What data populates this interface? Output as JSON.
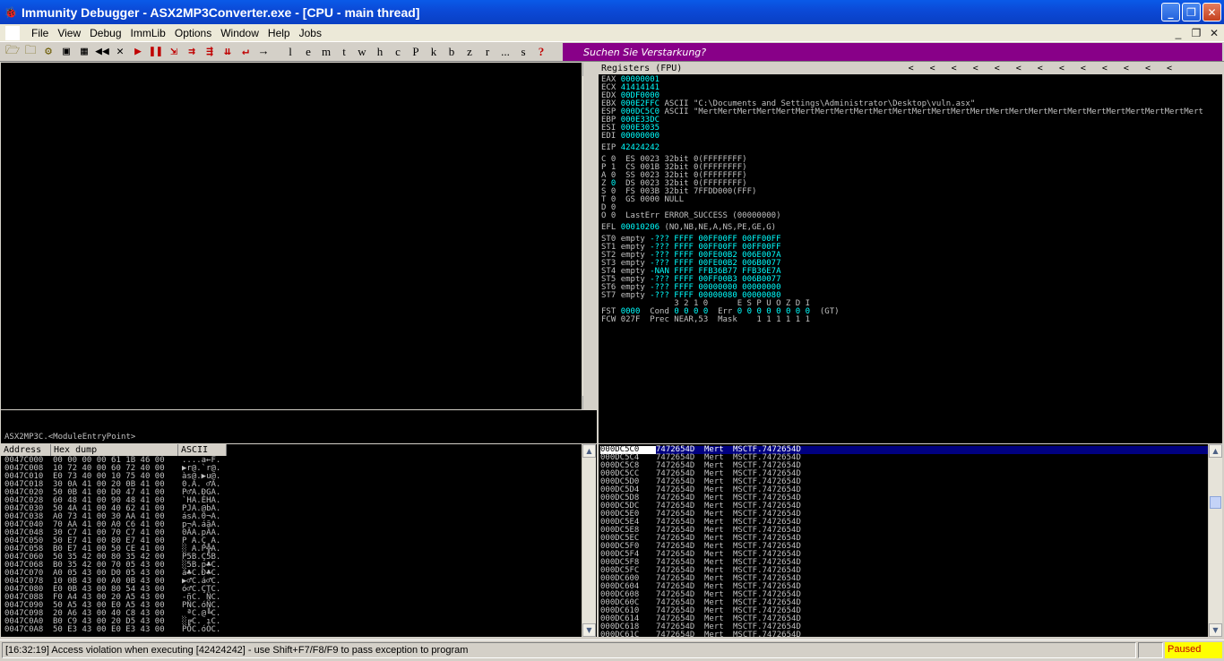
{
  "window": {
    "title": "Immunity Debugger - ASX2MP3Converter.exe - [CPU - main thread]",
    "minimize": "_",
    "restore": "❐",
    "close": "✕"
  },
  "menu": [
    "File",
    "View",
    "Debug",
    "ImmLib",
    "Options",
    "Window",
    "Help",
    "Jobs"
  ],
  "mdi": {
    "min": "_",
    "restore": "❐",
    "close": "✕"
  },
  "toolbar": {
    "icons": [
      {
        "name": "open-icon",
        "glyph": "🗁",
        "cls": "ico"
      },
      {
        "name": "reopen-icon",
        "glyph": "🗀",
        "cls": "ico"
      },
      {
        "name": "attach-icon",
        "glyph": "⚙",
        "cls": "ico"
      },
      {
        "name": "window-icon",
        "glyph": "▣",
        "cls": "blk"
      },
      {
        "name": "cpu-icon",
        "glyph": "▦",
        "cls": "blk"
      },
      {
        "name": "rewind-icon",
        "glyph": "◀◀",
        "cls": "blk"
      },
      {
        "name": "close-program-icon",
        "glyph": "✕",
        "cls": "blk"
      },
      {
        "name": "run-icon",
        "glyph": "▶",
        "cls": "red"
      },
      {
        "name": "pause-icon",
        "glyph": "❚❚",
        "cls": "red"
      },
      {
        "name": "step-into-icon",
        "glyph": "⇲",
        "cls": "red"
      },
      {
        "name": "step-over-icon",
        "glyph": "⇉",
        "cls": "red"
      },
      {
        "name": "trace-into-icon",
        "glyph": "⇶",
        "cls": "red"
      },
      {
        "name": "trace-over-icon",
        "glyph": "⇊",
        "cls": "red"
      },
      {
        "name": "execute-till-return-icon",
        "glyph": "↵",
        "cls": "red"
      },
      {
        "name": "go-to-icon",
        "glyph": "→",
        "cls": "blk"
      }
    ],
    "letters": [
      "l",
      "e",
      "m",
      "t",
      "w",
      "h",
      "c",
      "P",
      "k",
      "b",
      "z",
      "r",
      "...",
      "s",
      "?"
    ],
    "banner": "Suchen Sie Verstarkung?"
  },
  "registers": {
    "header": "Registers (FPU)",
    "arrows": [
      "<",
      "<",
      "<",
      "<",
      "<",
      "<",
      "<",
      "<",
      "<",
      "<",
      "<",
      "<",
      "<"
    ],
    "gp": [
      {
        "name": "EAX",
        "val": "00000001",
        "rest": ""
      },
      {
        "name": "ECX",
        "val": "41414141",
        "rest": ""
      },
      {
        "name": "EDX",
        "val": "00DF0000",
        "rest": ""
      },
      {
        "name": "EBX",
        "val": "000E2FFC",
        "rest": " ASCII \"C:\\Documents and Settings\\Administrator\\Desktop\\vuln.asx\""
      },
      {
        "name": "ESP",
        "val": "000DC5C0",
        "rest": " ASCII \"MertMertMertMertMertMertMertMertMertMertMertMertMertMertMertMertMertMertMertMertMertMertMertMertMertMert"
      },
      {
        "name": "EBP",
        "val": "000E33DC",
        "rest": ""
      },
      {
        "name": "ESI",
        "val": "000E3035",
        "rest": ""
      },
      {
        "name": "EDI",
        "val": "00000000",
        "rest": ""
      }
    ],
    "eip": {
      "name": "EIP",
      "val": "42424242"
    },
    "flags": [
      {
        "f": "C",
        "v": "0",
        "rest": "  ES 0023 32bit 0(FFFFFFFF)"
      },
      {
        "f": "P",
        "v": "1",
        "rest": "  CS 001B 32bit 0(FFFFFFFF)"
      },
      {
        "f": "A",
        "v": "0",
        "rest": "  SS 0023 32bit 0(FFFFFFFF)"
      },
      {
        "f": "Z",
        "v": "0",
        "rest": "  DS 0023 32bit 0(FFFFFFFF)"
      },
      {
        "f": "S",
        "v": "0",
        "rest": "  FS 003B 32bit 7FFDD000(FFF)"
      },
      {
        "f": "T",
        "v": "0",
        "rest": "  GS 0000 NULL"
      },
      {
        "f": "D",
        "v": "0",
        "rest": ""
      },
      {
        "f": "O",
        "v": "0",
        "rest": "  LastErr ERROR_SUCCESS (00000000)"
      }
    ],
    "efl": {
      "name": "EFL",
      "val": "00010206",
      "rest": " (NO,NB,NE,A,NS,PE,GE,G)"
    },
    "st": [
      {
        "name": "ST0",
        "tag": "empty",
        "val": "-??? FFFF 00FF00FF 00FF00FF"
      },
      {
        "name": "ST1",
        "tag": "empty",
        "val": "-??? FFFF 00FF00FF 00FF00FF"
      },
      {
        "name": "ST2",
        "tag": "empty",
        "val": "-??? FFFF 00FE00B2 006E007A"
      },
      {
        "name": "ST3",
        "tag": "empty",
        "val": "-??? FFFF 00FE00B2 006B0077"
      },
      {
        "name": "ST4",
        "tag": "empty",
        "val": "-NAN FFFF FFB36B77 FFB36E7A"
      },
      {
        "name": "ST5",
        "tag": "empty",
        "val": "-??? FFFF 00FF00B3 006B0077"
      },
      {
        "name": "ST6",
        "tag": "empty",
        "val": "-??? FFFF 00000000 00000000"
      },
      {
        "name": "ST7",
        "tag": "empty",
        "val": "-??? FFFF 00000080 00000080"
      }
    ],
    "fpu_labels": "               3 2 1 0      E S P U O Z D I",
    "fst": {
      "name": "FST",
      "val": "0000",
      "cond_label": "  Cond ",
      "cond": "0 0 0 0",
      "err_label": "  Err ",
      "err": "0 0 0 0 0 0 0 0",
      "tail": "  (GT)"
    },
    "fcw": {
      "name": "FCW",
      "val": "027F",
      "rest": "  Prec NEAR,53  Mask    1 1 1 1 1 1"
    }
  },
  "info": "ASX2MP3C.<ModuleEntryPoint>",
  "dump": {
    "headers": [
      "Address",
      "Hex dump",
      "ASCII"
    ],
    "rows": [
      [
        "0047C000",
        "00 00 00 00 61 1B 46 00",
        "....a←F."
      ],
      [
        "0047C008",
        "10 72 40 00 60 72 40 00",
        "▶r@.`r@."
      ],
      [
        "0047C010",
        "E0 73 40 00 10 75 40 00",
        "às@.▶u@."
      ],
      [
        "0047C018",
        "30 0A 41 00 20 0B 41 00",
        "0.A. ♂A."
      ],
      [
        "0047C020",
        "50 0B 41 00 D0 47 41 00",
        "P♂A.ÐGA."
      ],
      [
        "0047C028",
        "60 48 41 00 90 48 41 00",
        "`HA.ÉHA."
      ],
      [
        "0047C030",
        "50 4A 41 00 40 62 41 00",
        "PJA.@bA."
      ],
      [
        "0047C038",
        "A0 73 41 00 30 AA 41 00",
        "ásA.0¬A."
      ],
      [
        "0047C040",
        "70 AA 41 00 A0 C6 41 00",
        "p¬A.áãA."
      ],
      [
        "0047C048",
        "30 C7 41 00 70 C7 41 00",
        "0ÃA.pÃA."
      ],
      [
        "0047C050",
        "50 E7 41 00 80 E7 41 00",
        "P A.Ç A."
      ],
      [
        "0047C058",
        "B0 E7 41 00 50 CE 41 00",
        "░ A.P╬A."
      ],
      [
        "0047C060",
        "50 35 42 00 80 35 42 00",
        "P5B.Ç5B."
      ],
      [
        "0047C068",
        "B0 35 42 00 70 05 43 00",
        "░5B.p♣C."
      ],
      [
        "0047C070",
        "A0 05 43 00 D0 05 43 00",
        "á♣C.Ð♣C."
      ],
      [
        "0047C078",
        "10 0B 43 00 A0 0B 43 00",
        "▶♂C.á♂C."
      ],
      [
        "0047C080",
        "E0 0B 43 00 80 54 43 00",
        "ó♂C.ÇTC."
      ],
      [
        "0047C088",
        "F0 A4 43 00 20 A5 43 00",
        "-ñC. ÑC."
      ],
      [
        "0047C090",
        "50 A5 43 00 E0 A5 43 00",
        "PÑC.óÑC."
      ],
      [
        "0047C098",
        "20 A6 43 00 40 C8 43 00",
        " ªC.@╚C."
      ],
      [
        "0047C0A0",
        "B0 C9 43 00 20 D5 43 00",
        "░╔C. ıC."
      ],
      [
        "0047C0A8",
        "50 E3 43 00 E0 E3 43 00",
        "PÒC.óÒC."
      ]
    ]
  },
  "stack": {
    "rows": [
      [
        "000DC5C0",
        "7472654D",
        "Mert",
        "MSCTF.7472654D"
      ],
      [
        "000DC5C4",
        "7472654D",
        "Mert",
        "MSCTF.7472654D"
      ],
      [
        "000DC5C8",
        "7472654D",
        "Mert",
        "MSCTF.7472654D"
      ],
      [
        "000DC5CC",
        "7472654D",
        "Mert",
        "MSCTF.7472654D"
      ],
      [
        "000DC5D0",
        "7472654D",
        "Mert",
        "MSCTF.7472654D"
      ],
      [
        "000DC5D4",
        "7472654D",
        "Mert",
        "MSCTF.7472654D"
      ],
      [
        "000DC5D8",
        "7472654D",
        "Mert",
        "MSCTF.7472654D"
      ],
      [
        "000DC5DC",
        "7472654D",
        "Mert",
        "MSCTF.7472654D"
      ],
      [
        "000DC5E0",
        "7472654D",
        "Mert",
        "MSCTF.7472654D"
      ],
      [
        "000DC5E4",
        "7472654D",
        "Mert",
        "MSCTF.7472654D"
      ],
      [
        "000DC5E8",
        "7472654D",
        "Mert",
        "MSCTF.7472654D"
      ],
      [
        "000DC5EC",
        "7472654D",
        "Mert",
        "MSCTF.7472654D"
      ],
      [
        "000DC5F0",
        "7472654D",
        "Mert",
        "MSCTF.7472654D"
      ],
      [
        "000DC5F4",
        "7472654D",
        "Mert",
        "MSCTF.7472654D"
      ],
      [
        "000DC5F8",
        "7472654D",
        "Mert",
        "MSCTF.7472654D"
      ],
      [
        "000DC5FC",
        "7472654D",
        "Mert",
        "MSCTF.7472654D"
      ],
      [
        "000DC600",
        "7472654D",
        "Mert",
        "MSCTF.7472654D"
      ],
      [
        "000DC604",
        "7472654D",
        "Mert",
        "MSCTF.7472654D"
      ],
      [
        "000DC608",
        "7472654D",
        "Mert",
        "MSCTF.7472654D"
      ],
      [
        "000DC60C",
        "7472654D",
        "Mert",
        "MSCTF.7472654D"
      ],
      [
        "000DC610",
        "7472654D",
        "Mert",
        "MSCTF.7472654D"
      ],
      [
        "000DC614",
        "7472654D",
        "Mert",
        "MSCTF.7472654D"
      ],
      [
        "000DC618",
        "7472654D",
        "Mert",
        "MSCTF.7472654D"
      ],
      [
        "000DC61C",
        "7472654D",
        "Mert",
        "MSCTF.7472654D"
      ]
    ]
  },
  "scroll": {
    "up": "▲",
    "down": "▼"
  },
  "status": {
    "message": "[16:32:19] Access violation when executing [42424242] - use Shift+F7/F8/F9 to pass exception to program",
    "state": "Paused"
  },
  "colors": {
    "titlebar": "#0a4fd6",
    "banner": "#880088",
    "status_paused_bg": "#ffff00",
    "status_paused_fg": "#c00000",
    "register_value": "#00ffff",
    "selection": "#000080"
  }
}
